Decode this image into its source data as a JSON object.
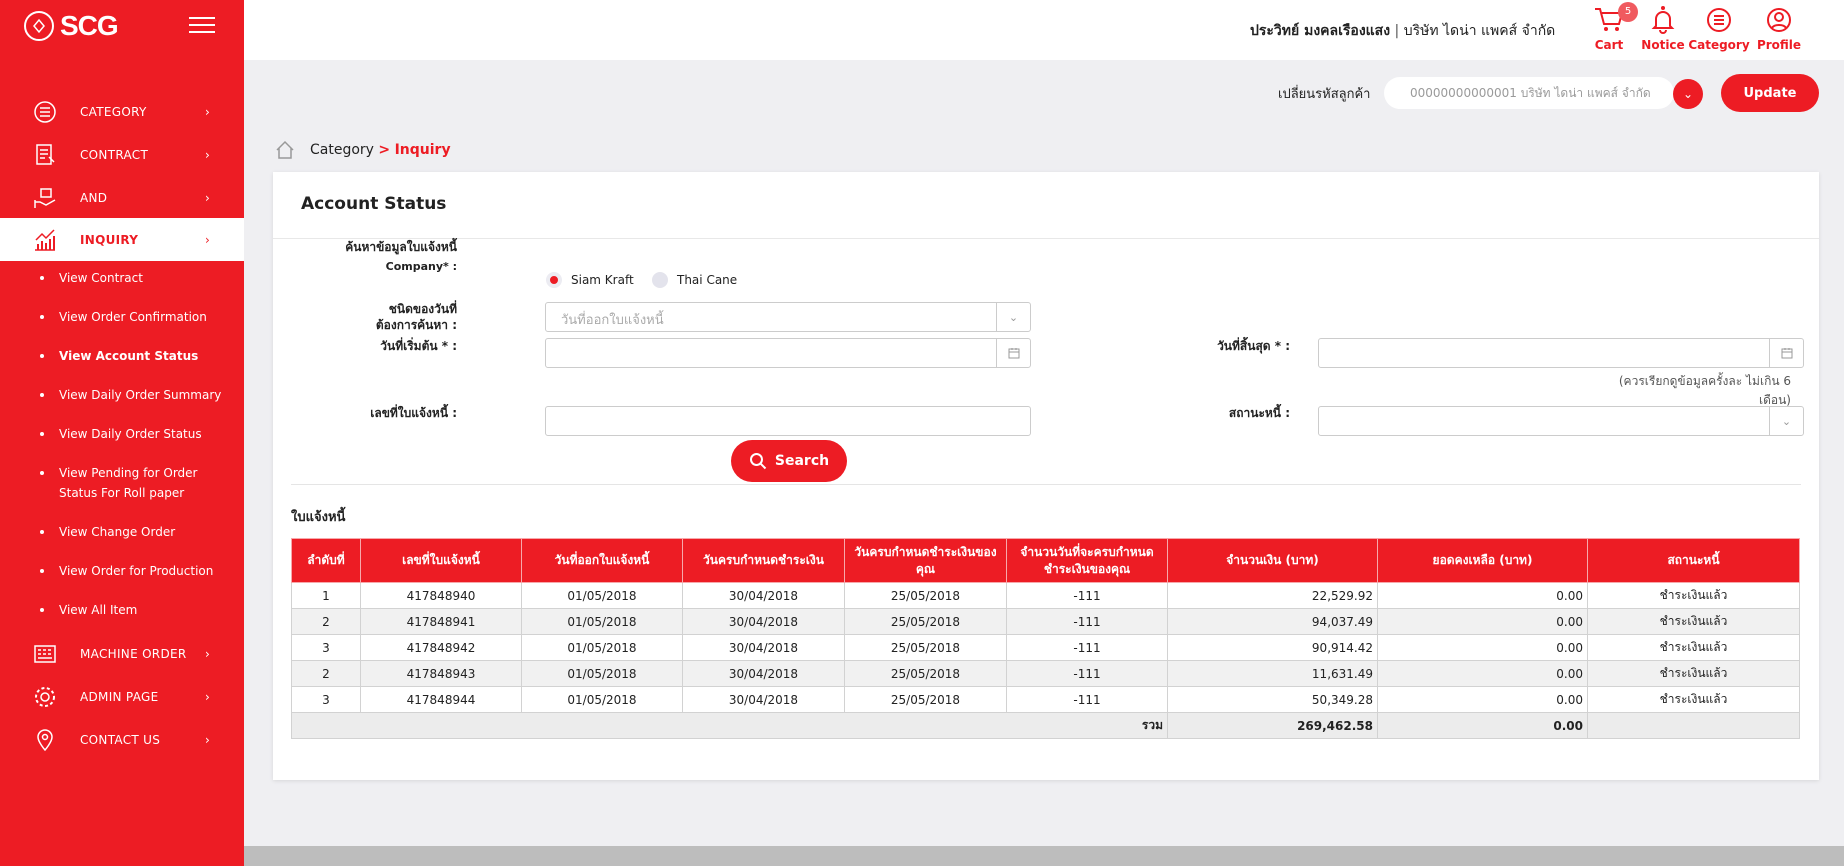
{
  "brand": {
    "logo_text": "SCG"
  },
  "sidebar": {
    "items": [
      {
        "label": "CATEGORY"
      },
      {
        "label": "CONTRACT"
      },
      {
        "label": "AND"
      },
      {
        "label": "INQUIRY"
      },
      {
        "label": "MACHINE ORDER"
      },
      {
        "label": "ADMIN PAGE"
      },
      {
        "label": "CONTACT US"
      }
    ],
    "chevron": "›",
    "sub_items": [
      {
        "label": "View Contract"
      },
      {
        "label": "View Order Confirmation"
      },
      {
        "label": "View Account Status"
      },
      {
        "label": "View Daily Order Summary"
      },
      {
        "label": "View Daily Order Status"
      },
      {
        "label": "View Pending for Order Status For Roll paper"
      },
      {
        "label": "View Change Order"
      },
      {
        "label": "View Order for Production"
      },
      {
        "label": "View All Item"
      }
    ]
  },
  "topbar": {
    "user_name": "ประวิทย์ มงคลเรืองแสง",
    "separator": "|",
    "company": "บริษัท ไดน่า แพคส์ จำกัด",
    "cart_label": "Cart",
    "cart_count": "5",
    "notice_label": "Notice",
    "category_label": "Category",
    "profile_label": "Profile"
  },
  "customer": {
    "label": "เปลี่ยนรหัสลูกค้า",
    "selected": "00000000000001 บริษัท ไดน่า แพคส์ จำกัด",
    "update_label": "Update"
  },
  "breadcrumb": {
    "parent": "Category",
    "sep": ">",
    "current": "Inquiry"
  },
  "form": {
    "title": "Account Status",
    "search_info_label": "ค้นหาข้อมูลใบแจ้งหนี้",
    "company_label": "Company* :",
    "company_options": [
      {
        "label": "Siam Kraft",
        "selected": true
      },
      {
        "label": "Thai Cane",
        "selected": false
      }
    ],
    "date_type_label_1": "ชนิดของวันที่",
    "date_type_label_2": "ต้องการค้นหา :",
    "date_type_value": "วันที่ออกใบแจ้งหนี้",
    "start_date_label": "วันที่เริ่มต้น * :",
    "end_date_label": "วันที่สิ้นสุด * :",
    "date_hint": "(ควรเรียกดูข้อมูลครั้งละ ไม่เกิน 6 เดือน)",
    "invoice_no_label": "เลขที่ใบแจ้งหนี้ :",
    "debt_status_label": "สถานะหนี้ :",
    "search_label": "Search"
  },
  "table": {
    "section_title": "ใบแจ้งหนี้",
    "headers": [
      "ลำดับที่",
      "เลขที่ใบแจ้งหนี้",
      "วันที่ออกใบแจ้งหนี้",
      "วันครบกำหนดชำระเงิน",
      "วันครบกำหนดชำระเงินของคุณ",
      "จำนวนวันที่จะครบกำหนดชำระเงินของคุณ",
      "จำนวนเงิน (บาท)",
      "ยอดคงเหลือ (บาท)",
      "สถานะหนี้"
    ],
    "rows": [
      [
        "1",
        "417848940",
        "01/05/2018",
        "30/04/2018",
        "25/05/2018",
        "-111",
        "22,529.92",
        "0.00",
        "ชำระเงินแล้ว"
      ],
      [
        "2",
        "417848941",
        "01/05/2018",
        "30/04/2018",
        "25/05/2018",
        "-111",
        "94,037.49",
        "0.00",
        "ชำระเงินแล้ว"
      ],
      [
        "3",
        "417848942",
        "01/05/2018",
        "30/04/2018",
        "25/05/2018",
        "-111",
        "90,914.42",
        "0.00",
        "ชำระเงินแล้ว"
      ],
      [
        "2",
        "417848943",
        "01/05/2018",
        "30/04/2018",
        "25/05/2018",
        "-111",
        "11,631.49",
        "0.00",
        "ชำระเงินแล้ว"
      ],
      [
        "3",
        "417848944",
        "01/05/2018",
        "30/04/2018",
        "25/05/2018",
        "-111",
        "50,349.28",
        "0.00",
        "ชำระเงินแล้ว"
      ]
    ],
    "total_label": "รวม",
    "total_amount": "269,462.58",
    "total_balance": "0.00"
  },
  "colors": {
    "accent": "#ed1c24",
    "background": "#efeff2"
  }
}
